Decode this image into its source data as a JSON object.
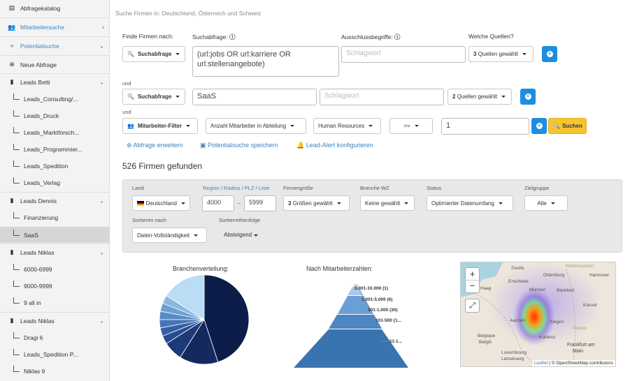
{
  "sidebar": {
    "catalog": "Abfragekatalog",
    "people_search": "Mitarbeitersuche",
    "potential_search": "Potentialsuche",
    "new_query": "Neue Abfrage",
    "groups": [
      {
        "title": "Leads Betti",
        "items": [
          "Leads_Consulting/...",
          "Leads_Druck",
          "Leads_Marktforsch...",
          "Leads_Programmier...",
          "Leads_Spedition",
          "Leads_Verlag"
        ]
      },
      {
        "title": "Leads Dennis",
        "items": [
          "Finanzierung",
          "SaaS"
        ]
      },
      {
        "title": "Leads Niklas",
        "items": [
          "6000-6999",
          "9000-9999",
          "9 all in"
        ]
      },
      {
        "title": "Leads Niklas",
        "items": [
          "Dragi 6",
          "Leads_Spedition P...",
          "Niklas 9"
        ]
      }
    ]
  },
  "header": {
    "breadcrumb": "Suche Firmen in: Deutschland, Österreich und Schweiz"
  },
  "search": {
    "find_by_label": "Finde Firmen nach:",
    "query_label": "Suchabfrage:",
    "exclude_label": "Ausschlussbegriffe:",
    "sources_label": "Welche Quellen?",
    "row1": {
      "type": "Suchabfrage",
      "query": "(url:jobs OR url:karriere OR url:stellenangebote)",
      "exclude_placeholder": "Schlagwort",
      "sources": "Quellen gewählt",
      "sources_count": "3"
    },
    "and1": "und",
    "row2": {
      "type": "Suchabfrage",
      "query": "SaaS",
      "exclude_placeholder": "Schlagwort",
      "sources": "Quellen gewählt",
      "sources_count": "2"
    },
    "and2": "und",
    "row3": {
      "type": "Mitarbeiter-Filter",
      "metric": "Anzahl Mitarbeiter in Abteilung",
      "department": "Human Resources",
      "operator": ">=",
      "value": "1",
      "search_button": "Suchen"
    },
    "actions": {
      "extend": "Abfrage erweitern",
      "save": "Potentialsuche speichern",
      "alert": "Lead-Alert konfigurieren"
    }
  },
  "results": {
    "count_text": "526 Firmen gefunden",
    "filters": {
      "land_label": "Land",
      "land_value": "Deutschland",
      "region_label": "Region",
      "radius_label": "Radius",
      "plz_label": "PLZ",
      "liste_label": "Liste",
      "plz_from": "4000",
      "dash": "–",
      "plz_to": "5999",
      "size_label": "Firmengröße",
      "size_count": "3",
      "size_value": "Größen gewählt",
      "branch_label": "Branche WZ",
      "branch_value": "Keine gewählt",
      "status_label": "Status",
      "status_value": "Optimierter Datenumfang",
      "target_label": "Zielgruppe",
      "target_value": "Alle",
      "sort_label": "Sortieren nach",
      "sort_value": "Daten-Vollständigkeit",
      "order_label": "Sortierreihenfolge",
      "order_value": "Absteigend"
    }
  },
  "chart_data": [
    {
      "type": "pie",
      "title": "Branchenverteilung:",
      "series": [
        {
          "values": [
            45,
            14,
            7,
            3,
            3,
            3,
            3,
            3,
            3,
            16
          ]
        }
      ],
      "colors": [
        "#0d1d4a",
        "#142a5e",
        "#1d3a78",
        "#284c8f",
        "#3560a6",
        "#4574b7",
        "#5989c6",
        "#6fa0d3",
        "#8bb7df",
        "#b8ddf5"
      ]
    },
    {
      "type": "bar",
      "title": "Nach Mitarbeiterzahlen:",
      "categories": [
        "5.001-10.000 (1)",
        "1.001-5.000 (6)",
        "501-1.000 (30)",
        "101-500 (1...",
        "11-1..."
      ],
      "values": [
        1,
        6,
        30,
        null,
        null
      ]
    }
  ],
  "map": {
    "zoom_in": "+",
    "zoom_out": "−",
    "fullscreen": "⤢",
    "places": [
      "Zwolle",
      "Oldenburg",
      "Hannover",
      "Enschede",
      "Niedersachsen",
      "Münster",
      "Bielefeld",
      "Haag",
      "Kassel",
      "Aachen",
      "Siegen",
      "Belgique",
      "België",
      "Koblenz",
      "Frankfurt am",
      "Main",
      "Luxembourg",
      "Letzebuerg",
      "Hessen"
    ],
    "attribution_leaflet": "Leaflet",
    "attribution_rest": "| © OpenStreetMap contributors"
  }
}
